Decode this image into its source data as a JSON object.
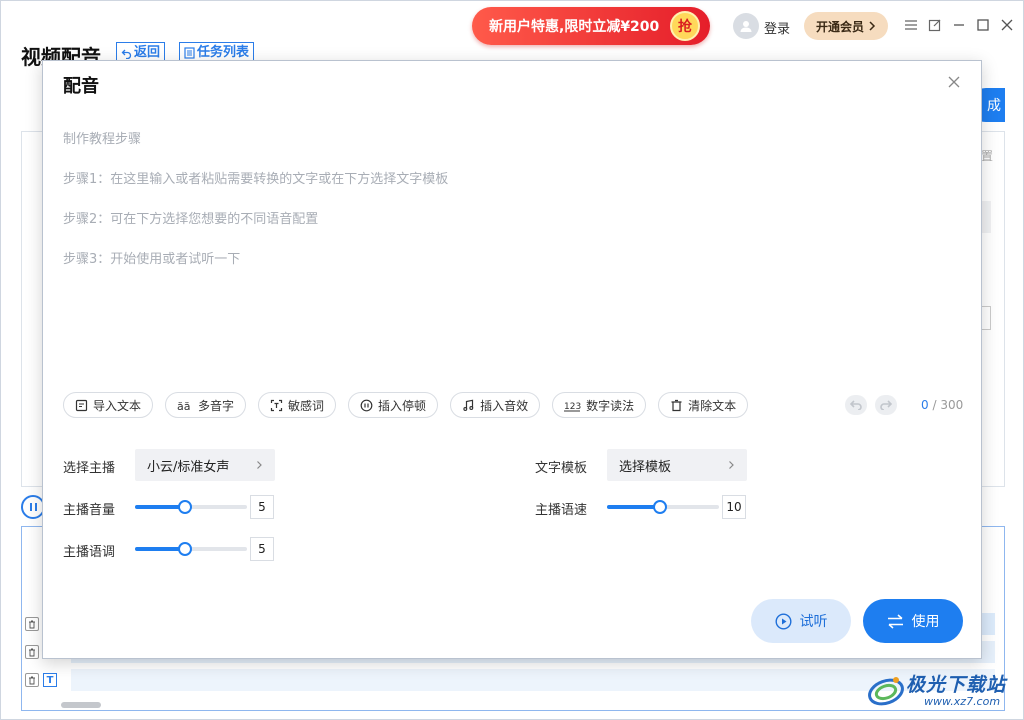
{
  "app": {
    "title": "视频配音",
    "back_label": "返回",
    "tasks_label": "任务列表",
    "promo_text": "新用户特惠,限时立减¥200",
    "promo_badge": "抢",
    "login_label": "登录",
    "vip_label": "开通会员",
    "bg_button_fragment": "成",
    "bg_side_fragment": "置",
    "accent_color": "#1e7ef0"
  },
  "watermark": {
    "name": "极光下载站",
    "url": "www.xz7.com"
  },
  "modal": {
    "title": "配音",
    "guide": {
      "heading": "制作教程步骤",
      "step1": "步骤1：在这里输入或者粘贴需要转换的文字或在下方选择文字模板",
      "step2": "步骤2：可在下方选择您想要的不同语音配置",
      "step3": "步骤3：开始使用或者试听一下"
    },
    "toolbar": {
      "import_text": "导入文本",
      "polyphone": "多音字",
      "sensitive": "敏感词",
      "insert_pause": "插入停顿",
      "insert_sfx": "插入音效",
      "number_reading": "数字读法",
      "clear_text": "清除文本"
    },
    "counter": {
      "current": "0",
      "max": "/ 300"
    },
    "settings": {
      "anchor_label": "选择主播",
      "anchor_value": "小云/标准女声",
      "template_label": "文字模板",
      "template_value": "选择模板",
      "volume_label": "主播音量",
      "volume_value": "5",
      "volume_fraction": 0.45,
      "speed_label": "主播语速",
      "speed_value": "10",
      "speed_fraction": 0.47,
      "pitch_label": "主播语调",
      "pitch_value": "5",
      "pitch_fraction": 0.45
    },
    "buttons": {
      "preview": "试听",
      "use": "使用"
    }
  }
}
